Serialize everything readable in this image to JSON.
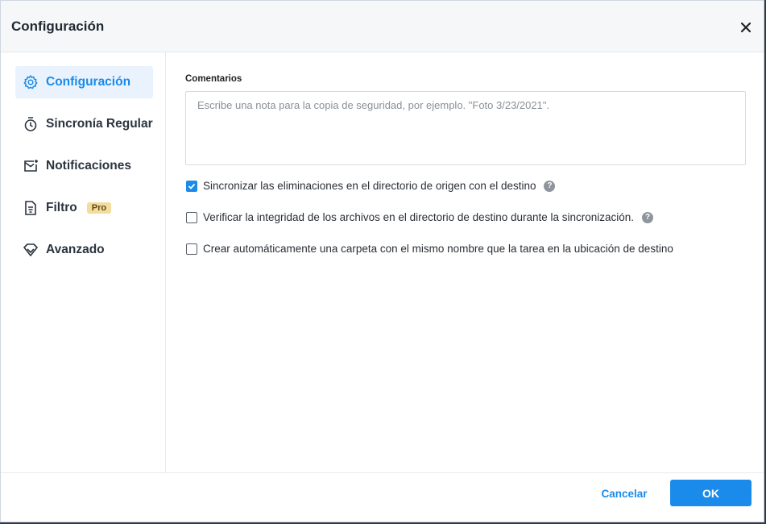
{
  "dialog": {
    "title": "Configuración",
    "close_icon": "close-icon"
  },
  "sidebar": {
    "items": [
      {
        "label": "Configuración",
        "icon": "gear-icon",
        "active": true
      },
      {
        "label": "Sincronía Regular",
        "icon": "timer-icon",
        "active": false
      },
      {
        "label": "Notificaciones",
        "icon": "mail-notification-icon",
        "active": false
      },
      {
        "label": "Filtro",
        "icon": "document-filter-icon",
        "active": false,
        "badge": "Pro"
      },
      {
        "label": "Avanzado",
        "icon": "diamond-icon",
        "active": false
      }
    ]
  },
  "main": {
    "comments_label": "Comentarios",
    "comments_placeholder": "Escribe una nota para la copia de seguridad, por ejemplo. \"Foto 3/23/2021\".",
    "options": [
      {
        "label": "Sincronizar las eliminaciones en el directorio de origen con el destino",
        "checked": true,
        "help": true
      },
      {
        "label": "Verificar la integridad de los archivos en el directorio de destino durante la sincronización.",
        "checked": false,
        "help": true
      },
      {
        "label": "Crear automáticamente una carpeta con el mismo nombre que la tarea en la ubicación de destino",
        "checked": false,
        "help": false
      }
    ],
    "help_glyph": "?"
  },
  "footer": {
    "cancel_label": "Cancelar",
    "ok_label": "OK"
  },
  "colors": {
    "accent": "#1a8bea",
    "active_bg": "#eaf3fd",
    "pro_badge": "#f3dc9c"
  }
}
